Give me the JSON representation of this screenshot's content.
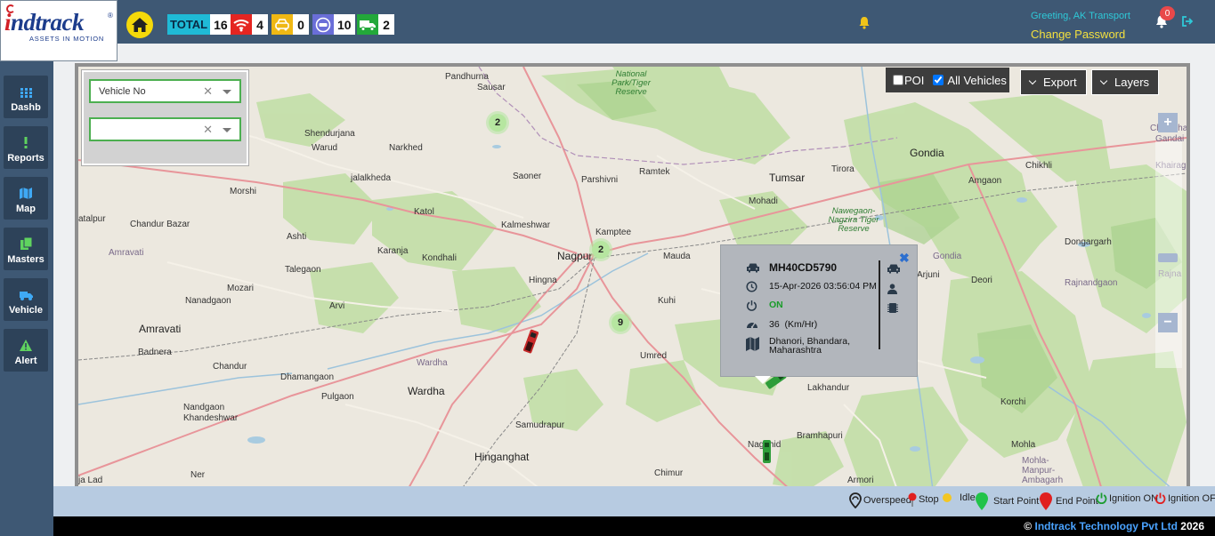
{
  "header": {
    "logo_text": "indtrack",
    "logo_tagline": "ASSETS IN MOTION",
    "logo_reg": "®",
    "stats": {
      "total_label": "TOTAL",
      "total": "16",
      "moving": "4",
      "idle": "0",
      "no_data": "10",
      "stopped": "2"
    },
    "greeting": "Greeting, AK Transport",
    "change_password": "Change Password",
    "notification_count": "0"
  },
  "sidebar": {
    "items": [
      {
        "label": "Dashb",
        "icon": "grid-icon"
      },
      {
        "label": "Reports",
        "icon": "exclamation-icon"
      },
      {
        "label": "Map",
        "icon": "map-icon"
      },
      {
        "label": "Masters",
        "icon": "file-copy-icon"
      },
      {
        "label": "Vehicle",
        "icon": "truck-icon"
      },
      {
        "label": "Alert",
        "icon": "warning-icon"
      }
    ]
  },
  "filters": {
    "vehicle_select_value": "Vehicle No",
    "second_select_value": ""
  },
  "map_controls": {
    "poi_label": "POI",
    "all_vehicles_label": "All Vehicles",
    "export_label": "Export",
    "layers_label": "Layers",
    "zoom_in": "+",
    "zoom_out": "−"
  },
  "clusters": [
    "2",
    "2",
    "9"
  ],
  "popup": {
    "vehicle_no": "MH40CD5790",
    "datetime": "15-Apr-2026 03:56:04 PM",
    "ignition": "ON",
    "speed": "36",
    "speed_unit": "(Km/Hr)",
    "location": "Dhanori, Bhandara, Maharashtra"
  },
  "map_labels": {
    "pandhurna": "Pandhurna",
    "sausar": "Sausar",
    "pench": "National Park/Tiger Reserve",
    "shendurjana": "Shendurjana",
    "warud": "Warud",
    "narkhed": "Narkhed",
    "morshi": "Morshi",
    "jalalkheda": "jalalkheda",
    "saoner": "Saoner",
    "parshivni": "Parshivni",
    "ramtek": "Ramtek",
    "tumsar": "Tumsar",
    "tirora": "Tirora",
    "gondia": "Gondia",
    "amgaon": "Amgaon",
    "chikhli": "Chikhli",
    "khairag": "Khairag",
    "chhuikhadan": "Chhuikhadan",
    "gandai": "Gandai",
    "katol": "Katol",
    "kalmeshwar": "Kalmeshwar",
    "kamptee": "Kamptee",
    "mohadi": "Mohadi",
    "nagzira": "Nawegaon-Nagzira Tiger Reserve",
    "achalpur": "atalpur",
    "chandur_bazar": "Chandur Bazar",
    "ashti": "Ashti",
    "amravati_faint": "Amravati",
    "karanja": "Karanja",
    "kondhali": "Kondhali",
    "nagpur": "Nagpur",
    "mauda": "Mauda",
    "dongargarh": "Dongargarh",
    "talegaon": "Talegaon",
    "hingna": "Hingna",
    "arjuni": "Arjuni",
    "deori": "Deori",
    "gondia_faint": "Gondia",
    "rajnandgaon": "Rajnandgaon",
    "mozari": "Mozari",
    "nanadgaon": "Nanadgaon",
    "arvi": "Arvi",
    "kuhi": "Kuhi",
    "rajna": "Rajna",
    "amravati": "Amravati",
    "badnera": "Badnera",
    "umred": "Umred",
    "chandur": "Chandur",
    "wardha_faint": "Wardha",
    "dhamangaon": "Dhamangaon",
    "wardha": "Wardha",
    "pulgaon": "Pulgaon",
    "lakhandur": "Lakhandur",
    "nandgaon": "Nandgaon Khandeshwar",
    "korchi": "Korchi",
    "samudrapur": "Samudrapur",
    "bramhapuri": "Bramhapuri",
    "mohla": "Mohla",
    "hinganghat": "Hinganghat",
    "nagbhid": "Nagbhid",
    "manpur": "Mohla-Manpur-Ambagarh",
    "ner": "Ner",
    "chimur": "Chimur",
    "armori": "Armori",
    "jalad": "ja Lad"
  },
  "legend": {
    "overspeed": "Overspeed",
    "stop": "Stop",
    "idle": "Idle",
    "start_point": "Start Point",
    "end_point": "End Point",
    "ignition_on": "Ignition ON",
    "ignition_off": "Ignition OFF"
  },
  "footer": {
    "copyright": "©",
    "company": "Indtrack Technology Pvt Ltd",
    "year": "2026"
  },
  "colors": {
    "header_bg": "#3e5874",
    "accent_yellow": "#f5d90a",
    "total_cyan": "#1fbad6",
    "moving_red": "#e52521",
    "idle_amber": "#f0b814",
    "nodata_purple": "#6a6ed8",
    "stopped_green": "#23a83a"
  }
}
